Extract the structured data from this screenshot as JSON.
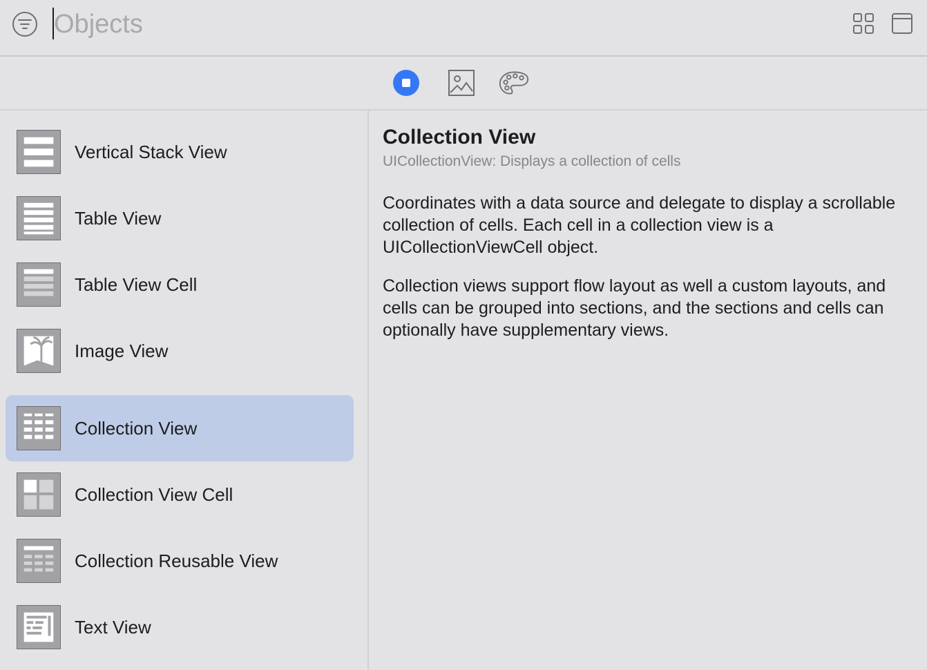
{
  "search": {
    "placeholder": "Objects",
    "value": ""
  },
  "toolbar": {
    "filter_icon": "filter-icon",
    "grid_icon": "grid-view-icon",
    "window_icon": "window-icon"
  },
  "tabs": [
    {
      "name": "objects",
      "icon": "objects-icon",
      "selected": true,
      "accent": "#3478f6"
    },
    {
      "name": "media",
      "icon": "image-icon",
      "selected": false
    },
    {
      "name": "colors",
      "icon": "palette-icon",
      "selected": false
    }
  ],
  "items": [
    {
      "label": "",
      "icon": "stack-view-icon"
    },
    {
      "label": "Vertical Stack View",
      "icon": "vertical-stack-view-icon"
    },
    {
      "label": "Table View",
      "icon": "table-view-icon"
    },
    {
      "label": "Table View Cell",
      "icon": "table-view-cell-icon"
    },
    {
      "label": "Image View",
      "icon": "image-view-icon"
    },
    {
      "label": "Collection View",
      "icon": "collection-view-icon",
      "selected": true
    },
    {
      "label": "Collection View Cell",
      "icon": "collection-view-cell-icon"
    },
    {
      "label": "Collection Reusable View",
      "icon": "collection-reusable-view-icon"
    },
    {
      "label": "Text View",
      "icon": "text-view-icon"
    }
  ],
  "detail": {
    "title": "Collection View",
    "subtitle": "UICollectionView: Displays a collection of cells",
    "paragraphs": [
      "Coordinates with a data source and delegate to display a scrollable collection of cells. Each cell in a collection view is a UICollectionViewCell object.",
      "Collection views support flow layout as well a custom layouts, and cells can be grouped into sections, and the sections and cells can optionally have supplementary views."
    ]
  },
  "colors": {
    "selection": "#bfcce8",
    "accent": "#3478f6",
    "background": "#e3e2e5"
  }
}
